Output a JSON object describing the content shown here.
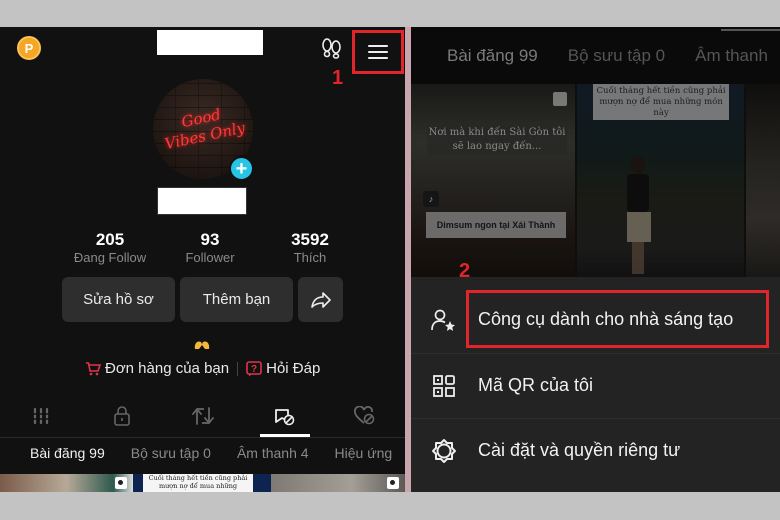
{
  "left_panel": {
    "coin_icon_label": "P",
    "stats": [
      {
        "value": "205",
        "label": "Đang Follow"
      },
      {
        "value": "93",
        "label": "Follower"
      },
      {
        "value": "3592",
        "label": "Thích"
      }
    ],
    "buttons": {
      "edit_profile": "Sửa hồ sơ",
      "add_friend": "Thêm bạn"
    },
    "links": {
      "orders": "Đơn hàng của bạn",
      "qa": "Hỏi Đáp"
    },
    "icon_tabs": [
      "grid-icon",
      "lock-icon",
      "repost-icon",
      "bookmark-icon",
      "liked-icon"
    ],
    "active_icon_tab": 3,
    "subtabs": [
      "Bài đăng 99",
      "Bộ sưu tập 0",
      "Âm thanh 4",
      "Hiệu ứng"
    ],
    "thumb_caption": "Cuối tháng hết tiền cũng phải mượn nợ để mua những",
    "step_marker": "1",
    "avatar_text": "Good Vibes Only"
  },
  "right_panel": {
    "tabs": [
      "Bài đăng 99",
      "Bộ sưu tập 0",
      "Âm thanh"
    ],
    "videos": [
      {
        "caption": "Nơi mà khi đến Sài Gòn tôi sẽ lao ngay đến...",
        "label": "Dimsum ngon tại Xái Thành"
      },
      {
        "caption": "Cuối tháng hết tiền cũng phải mượn nợ để mua những món này"
      }
    ],
    "step_marker": "2",
    "menu": [
      {
        "label": "Công cụ dành cho nhà sáng tạo",
        "icon": "creator-tools-icon",
        "highlighted": true
      },
      {
        "label": "Mã QR của tôi",
        "icon": "qr-code-icon",
        "highlighted": false
      },
      {
        "label": "Cài đặt và quyền riêng tư",
        "icon": "settings-icon",
        "highlighted": false
      }
    ]
  },
  "colors": {
    "highlight": "#e0262b",
    "coin": "#f5a623",
    "add_badge": "#27c4e6",
    "link_icon": "#e0344a",
    "background": "#111111"
  }
}
